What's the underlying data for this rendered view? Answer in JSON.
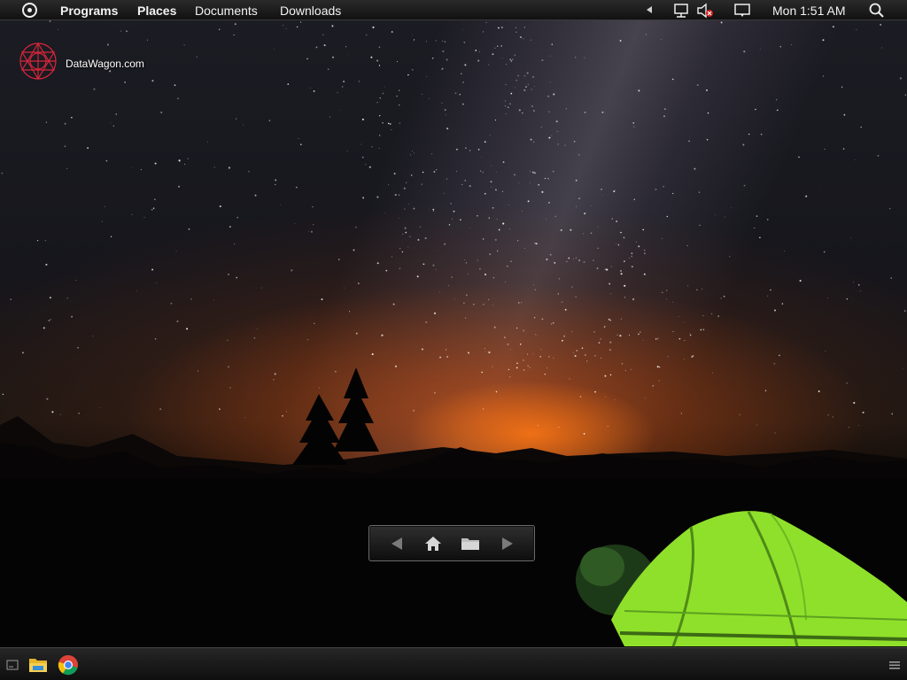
{
  "top_panel": {
    "menus": [
      {
        "label": "Programs"
      },
      {
        "label": "Places"
      },
      {
        "label": "Documents"
      },
      {
        "label": "Downloads"
      }
    ],
    "clock": "Mon 1:51 AM"
  },
  "desktop": {
    "icons": [
      {
        "label": "DataWagon.com",
        "icon": "datawagon-logo-icon"
      }
    ]
  },
  "taskbar": {
    "launchers": [
      {
        "icon": "show-desktop-icon"
      },
      {
        "icon": "file-explorer-icon"
      },
      {
        "icon": "chrome-icon"
      }
    ],
    "menu_icon": "hamburger-menu-icon"
  },
  "colors": {
    "tent_green": "#8fe02a",
    "horizon_orange": "#ff7a1a",
    "logo_red": "#d8263a"
  }
}
